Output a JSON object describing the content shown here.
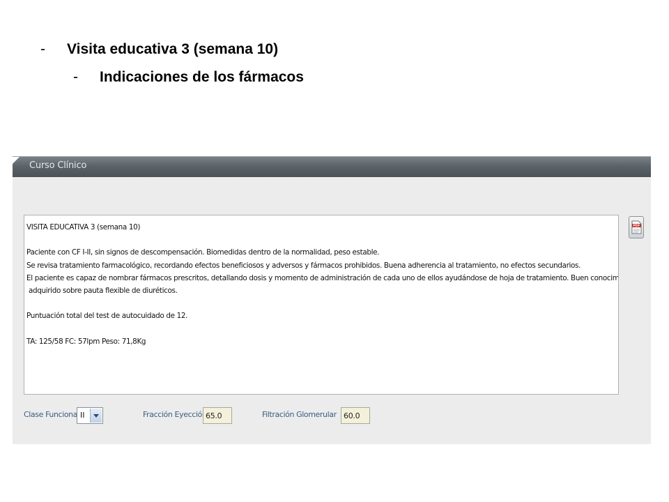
{
  "slide": {
    "bullet1": "Visita educativa 3 (semana 10)",
    "bullet2": "Indicaciones de los fármacos",
    "dash": "-"
  },
  "panel": {
    "title": "Curso Clínico",
    "notes_lines": [
      "VISITA EDUCATIVA 3 (semana 10)",
      "",
      "Paciente con CF I-II, sin signos de descompensación. Biomedidas dentro de la normalidad, peso estable.",
      "Se revisa tratamiento farmacológico, recordando efectos beneficiosos y adversos y fármacos prohibidos. Buena adherencia al tratamiento, no efectos secundarios.",
      "El paciente es capaz de nombrar fármacos prescritos, detallando dosis y momento de administración de cada uno de ellos ayudándose de hoja de tratamiento. Buen conocimiento",
      " adquirido sobre pauta flexible de diuréticos.",
      "",
      "Puntuación total del test de autocuidado de 12.",
      "",
      "TA: 125/58 FC: 57lpm Peso: 71,8Kg"
    ],
    "pdf_icon": "pdf-icon",
    "clase_funcional": {
      "label": "Clase Funcional",
      "selected": "II"
    },
    "fraccion_eyeccion": {
      "label": "Fracción Eyección",
      "value": "65.0"
    },
    "filtracion_glomerular": {
      "label": "Filtración Glomerular",
      "value": "60.0"
    }
  }
}
